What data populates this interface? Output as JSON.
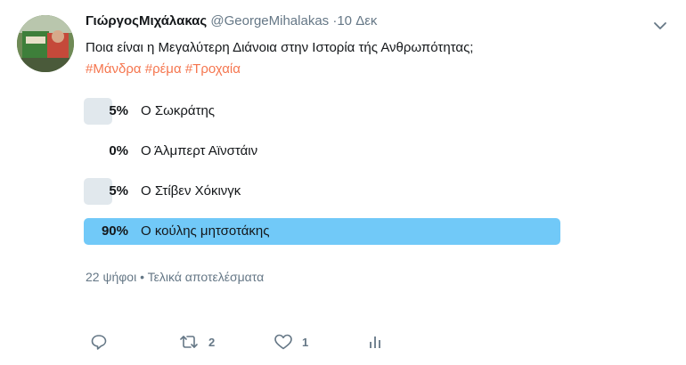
{
  "tweet": {
    "author_name": "ΓιώργοςΜιχάλακας",
    "handle": "@GeorgeMihalakas",
    "timestamp": "·10 Δεκ",
    "text": "Ποια είναι η Μεγαλύτερη Διάνοια στην Ιστορία τής Ανθρωπότητας;",
    "hashtags": [
      "#Μάνδρα",
      "#ρέμα",
      "#Τροχαία"
    ]
  },
  "poll": {
    "options": [
      {
        "percent_label": "5%",
        "label": "Ο Σωκράτης",
        "fraction": 0.05,
        "winner": false
      },
      {
        "percent_label": "0%",
        "label": "Ο Άλμπερτ Αϊνστάιν",
        "fraction": 0.0,
        "winner": false
      },
      {
        "percent_label": "5%",
        "label": "Ο Στίβεν Χόκινγκ",
        "fraction": 0.05,
        "winner": false
      },
      {
        "percent_label": "90%",
        "label": "Ο κούλης μητσοτάκης",
        "fraction": 0.9,
        "winner": true
      }
    ],
    "meta": "22 ψήφοι • Τελικά αποτελέσματα"
  },
  "actions": {
    "reply_count": "",
    "retweet_count": "2",
    "like_count": "1"
  },
  "colors": {
    "hashtag": "#f5764f",
    "winner_bar": "#71c9f8",
    "bar": "#e1e8ed",
    "muted": "#657786"
  },
  "icons": [
    "avatar",
    "chevron-down-icon",
    "reply-icon",
    "retweet-icon",
    "like-icon",
    "analytics-icon"
  ]
}
